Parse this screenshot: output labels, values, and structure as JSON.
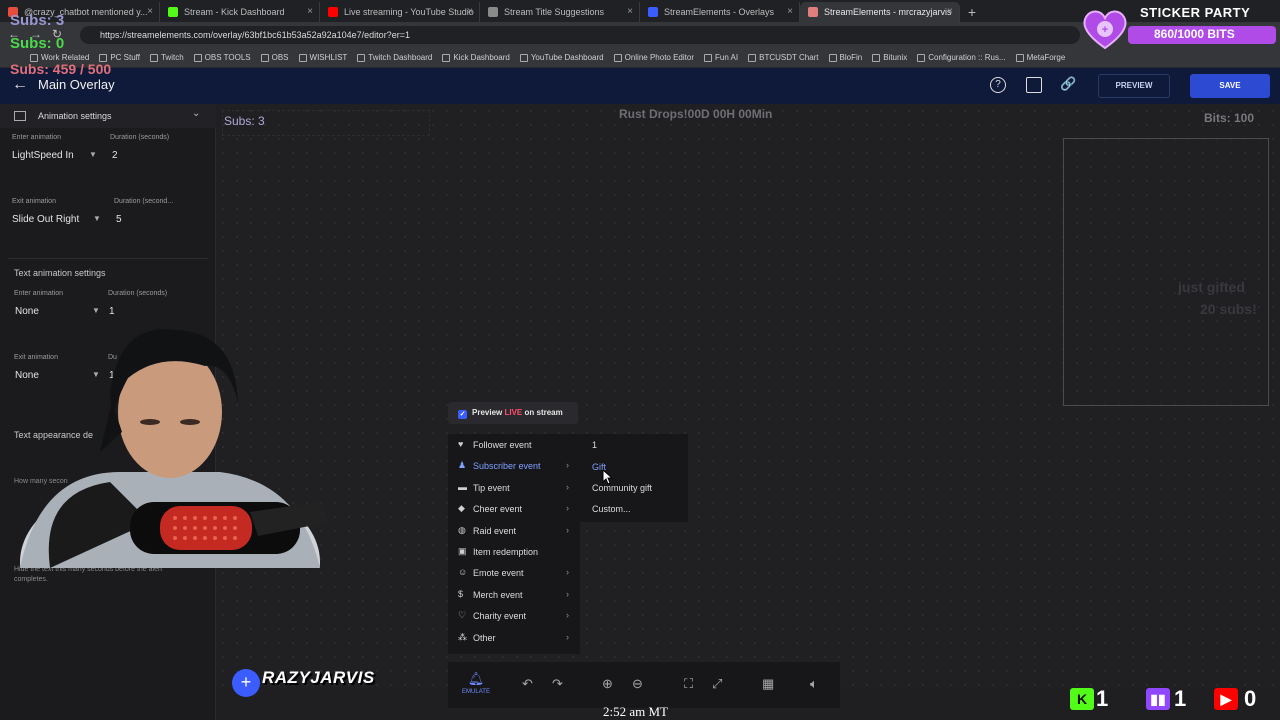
{
  "browser": {
    "tabs": [
      {
        "title": "@crazy_chatbot mentioned y...",
        "icon": "gmail-icon",
        "color": "#e84c3d"
      },
      {
        "title": "Stream - Kick Dashboard",
        "icon": "kick-icon",
        "color": "#53fc18"
      },
      {
        "title": "Live streaming - YouTube Studio",
        "icon": "youtube-icon",
        "color": "#ff0000"
      },
      {
        "title": "Stream Title Suggestions",
        "icon": "chatgpt-icon",
        "color": "#8a8a8a"
      },
      {
        "title": "StreamElements - Overlays",
        "icon": "streamelements-icon",
        "color": "#3b5cff"
      },
      {
        "title": "StreamElements - mrcrazyjarvis",
        "icon": "streamelements-icon",
        "color": "#e07e7e"
      }
    ],
    "url": "https://streamelements.com/overlay/63bf1bc61b53a52a92a104e7/editor?er=1",
    "bookmarks": [
      "Work Related",
      "PC Stuff",
      "Twitch",
      "OBS TOOLS",
      "OBS",
      "WISHLIST",
      "Twitch Dashboard",
      "Kick Dashboard",
      "YouTube Dashboard",
      "Online Photo Editor",
      "Fun AI",
      "BTCUSDT Chart",
      "BloFin",
      "Bitunix",
      "Configuration :: Rus...",
      "MetaForge"
    ]
  },
  "header": {
    "title": "Main Overlay",
    "preview_label": "PREVIEW",
    "save_label": "SAVE"
  },
  "left_panel": {
    "animation_settings": "Animation settings",
    "enter_animation_label": "Enter animation",
    "enter_duration_label": "Duration (seconds)",
    "enter_animation_value": "LightSpeed In",
    "enter_duration_value": "2",
    "exit_animation_label": "Exit animation",
    "exit_duration_label": "Duration (second...",
    "exit_animation_value": "Slide Out Right",
    "exit_duration_value": "5",
    "text_animation_settings": "Text animation settings",
    "text_enter_label": "Enter animation",
    "text_enter_duration_label": "Duration (seconds)",
    "text_enter_value": "None",
    "text_enter_duration_value": "1",
    "text_exit_label": "Exit animation",
    "text_exit_duration_label": "Du",
    "text_exit_value": "None",
    "text_exit_duration_value": "1",
    "text_appearance": "Text appearance de",
    "how_many_seconds": "How many secon",
    "hide_text_hint_1": "Hide the text this many seconds before the alert",
    "hide_text_hint_2": "completes."
  },
  "canvas": {
    "subs_label": "Subs: 3",
    "countdown": "Rust Drops!00D 00H 00Min",
    "bits_label": "Bits: 100",
    "alert_line1": "just gifted",
    "alert_line2": "20 subs!"
  },
  "context_menu": {
    "preview_prefix": "Preview",
    "preview_live": "LIVE",
    "preview_suffix": "on stream",
    "items": [
      {
        "label": "Follower event",
        "icon": "heart-icon",
        "glyph": "♥",
        "submenu": false
      },
      {
        "label": "Subscriber event",
        "icon": "user-icon",
        "glyph": "♟",
        "submenu": true
      },
      {
        "label": "Tip event",
        "icon": "wallet-icon",
        "glyph": "▬",
        "submenu": true
      },
      {
        "label": "Cheer event",
        "icon": "diamond-icon",
        "glyph": "◆",
        "submenu": true
      },
      {
        "label": "Raid event",
        "icon": "globe-icon",
        "glyph": "◍",
        "submenu": true
      },
      {
        "label": "Item redemption",
        "icon": "gift-icon",
        "glyph": "▣",
        "submenu": false
      },
      {
        "label": "Emote event",
        "icon": "smile-icon",
        "glyph": "☺",
        "submenu": true
      },
      {
        "label": "Merch event",
        "icon": "dollar-icon",
        "glyph": "$",
        "submenu": true
      },
      {
        "label": "Charity event",
        "icon": "charity-icon",
        "glyph": "♡",
        "submenu": true
      },
      {
        "label": "Other",
        "icon": "other-icon",
        "glyph": "⁂",
        "submenu": true
      }
    ],
    "submenu": [
      "1",
      "Gift",
      "Community gift",
      "Custom..."
    ]
  },
  "toolbar": {
    "emulate_label": "EMULATE"
  },
  "overlay": {
    "subs_top": "Subs: 3",
    "subs_green": "Subs: 0",
    "sub_goal": "Subs: 459 / 500",
    "sticker_title": "STICKER PARTY",
    "sticker_progress": "860/1000 BITS",
    "brand": "RAZYJARVIS",
    "clock": "2:52 am MT",
    "kick_count": "1",
    "twitch_count": "1",
    "youtube_count": "0"
  },
  "colors": {
    "accent": "#3b5cff",
    "header_bg": "#0f1a3a",
    "kick": "#53fc18",
    "twitch": "#9146ff",
    "youtube": "#ff0000",
    "sticker": "#b04be8"
  }
}
